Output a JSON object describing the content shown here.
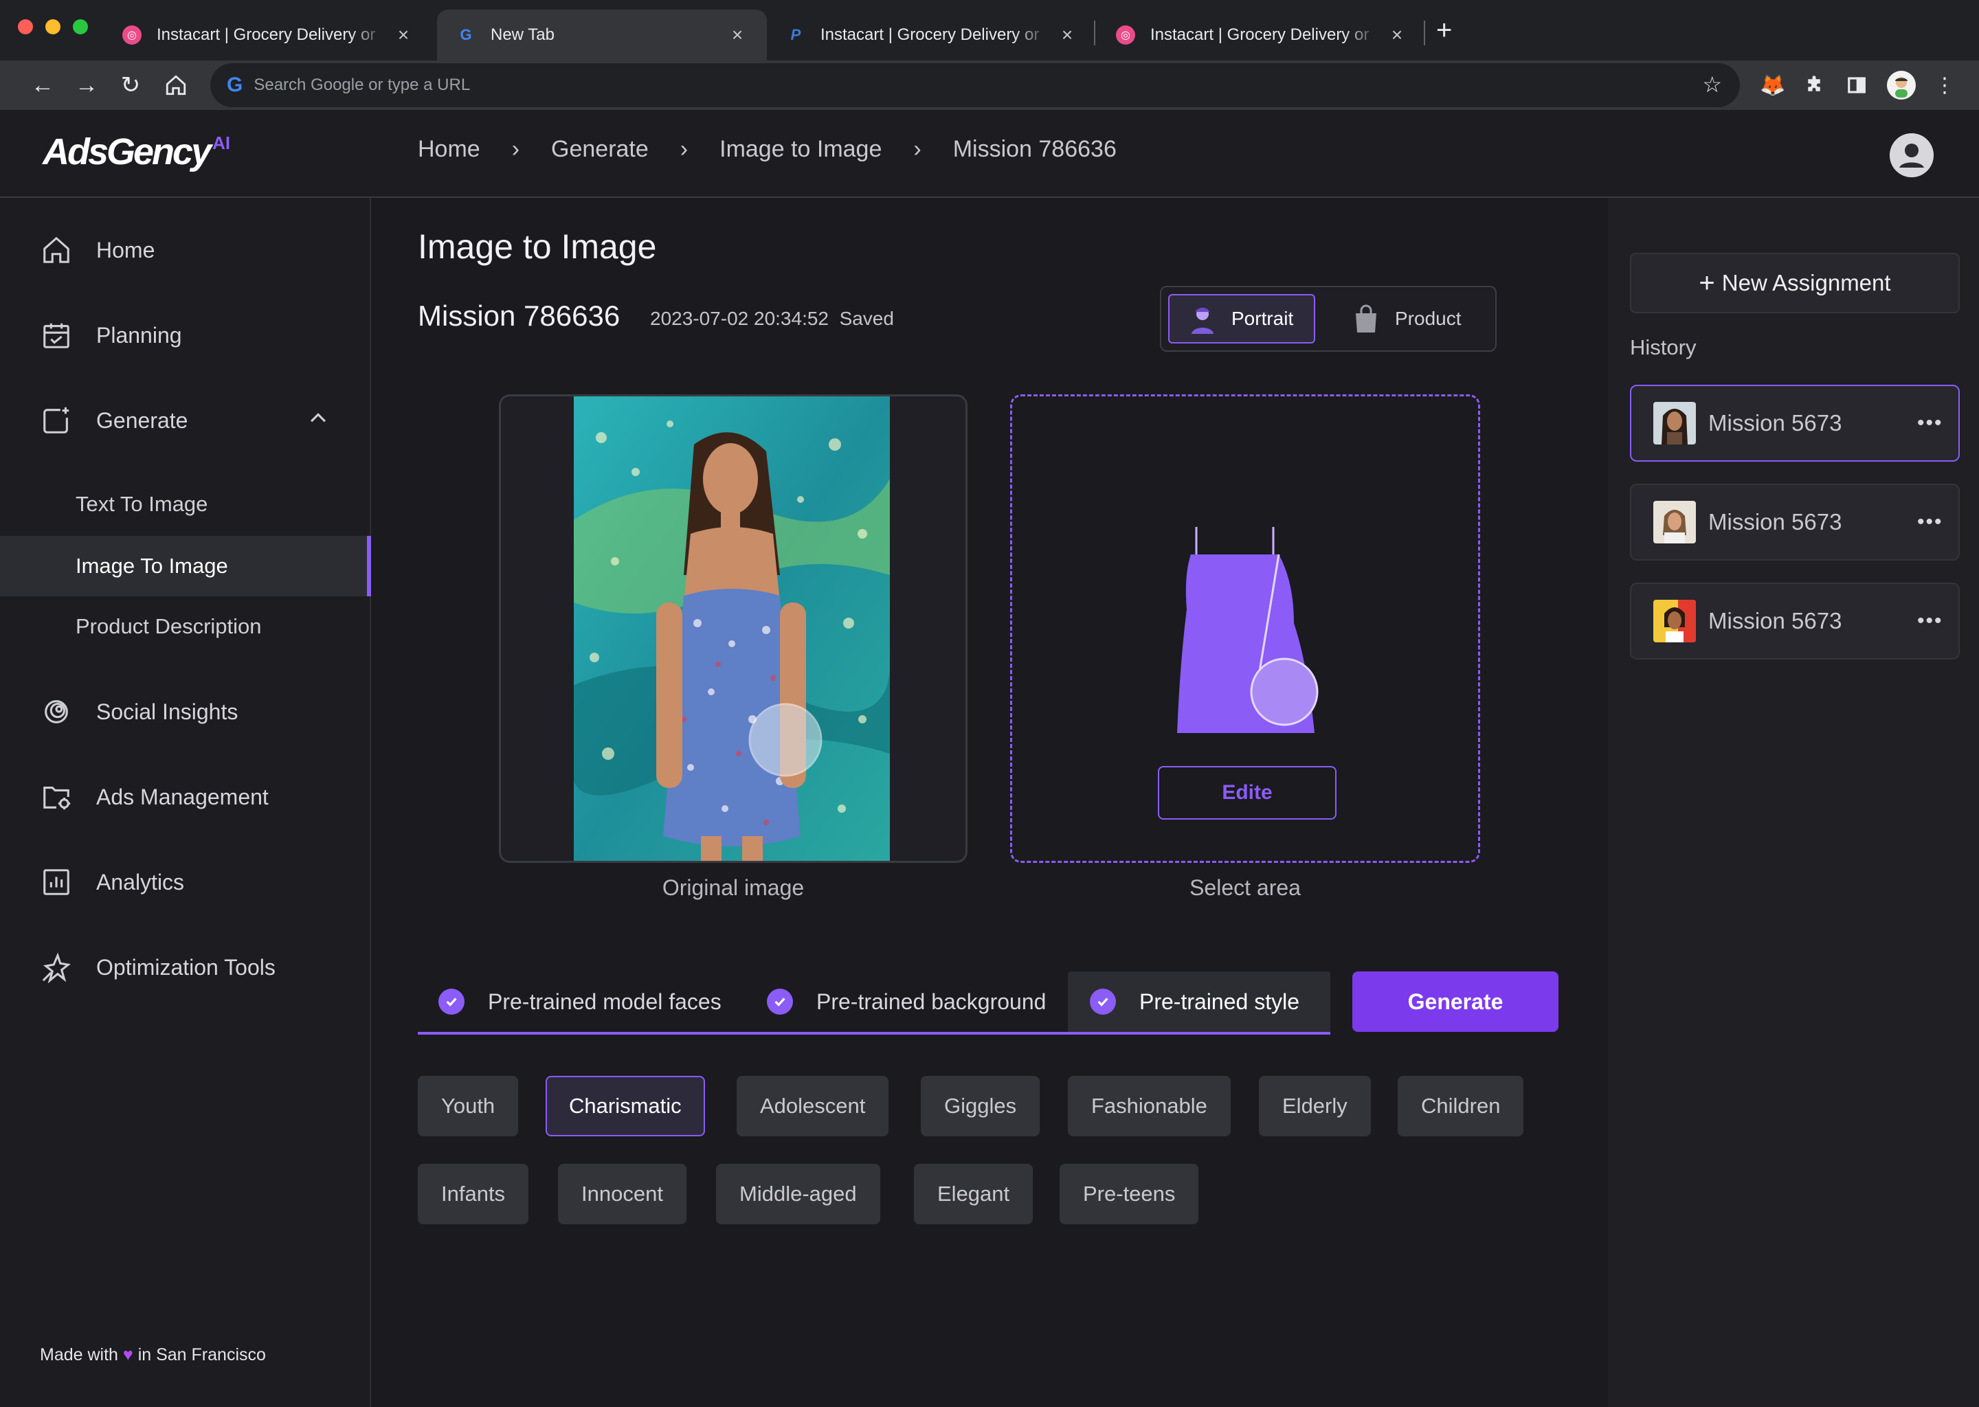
{
  "browser": {
    "tabs": [
      {
        "title": "Instacart | Grocery Delivery or",
        "favicon": "dribbble-icon",
        "active": false
      },
      {
        "title": "New Tab",
        "favicon": "google-icon",
        "active": true
      },
      {
        "title": "Instacart | Grocery Delivery or",
        "favicon": "paypal-icon",
        "active": false
      },
      {
        "title": "Instacart | Grocery Delivery or",
        "favicon": "dribbble-icon",
        "active": false
      }
    ],
    "omnibox_placeholder": "Search Google or type a URL"
  },
  "header": {
    "logo_text": "AdsGency",
    "logo_suffix": "AI",
    "breadcrumb": [
      "Home",
      "Generate",
      "Image to Image",
      "Mission 786636"
    ]
  },
  "sidebar": {
    "items": [
      {
        "label": "Home",
        "icon": "home-icon"
      },
      {
        "label": "Planning",
        "icon": "calendar-icon"
      },
      {
        "label": "Generate",
        "icon": "image-sparkle-icon"
      },
      {
        "label": "Social Insights",
        "icon": "rings-icon"
      },
      {
        "label": "Ads Management",
        "icon": "folder-gear-icon"
      },
      {
        "label": "Analytics",
        "icon": "bar-chart-icon"
      },
      {
        "label": "Optimization Tools",
        "icon": "sparkle-star-icon"
      }
    ],
    "sub_items": [
      "Text To Image",
      "Image To Image",
      "Product Description"
    ],
    "active_sub": "Image To Image",
    "footer_before": "Made with",
    "footer_after": "in San Francisco"
  },
  "main": {
    "page_title": "Image to Image",
    "mission_title": "Mission 786636",
    "timestamp": "2023-07-02 20:34:52",
    "saved": "Saved",
    "modes": {
      "portrait": "Portrait",
      "product": "Product",
      "selected": "Portrait"
    },
    "original_label": "Original image",
    "select_label": "Select area",
    "edit_label": "Edite",
    "option_tabs": [
      "Pre-trained model faces",
      "Pre-trained background",
      "Pre-trained style"
    ],
    "active_option": "Pre-trained style",
    "generate_label": "Generate",
    "chips": [
      "Youth",
      "Charismatic",
      "Adolescent",
      "Giggles",
      "Fashionable",
      "Elderly",
      "Children",
      "Infants",
      "Innocent",
      "Middle-aged",
      "Elegant",
      "Pre-teens"
    ],
    "selected_chip": "Charismatic"
  },
  "right_panel": {
    "new_assignment": "New Assignment",
    "history_label": "History",
    "history": [
      {
        "name": "Mission 5673",
        "active": true
      },
      {
        "name": "Mission 5673",
        "active": false
      },
      {
        "name": "Mission 5673",
        "active": false
      }
    ]
  },
  "colors": {
    "accent": "#8b5cf6",
    "accent_button": "#7c3aed",
    "background": "#1a1a1f"
  }
}
